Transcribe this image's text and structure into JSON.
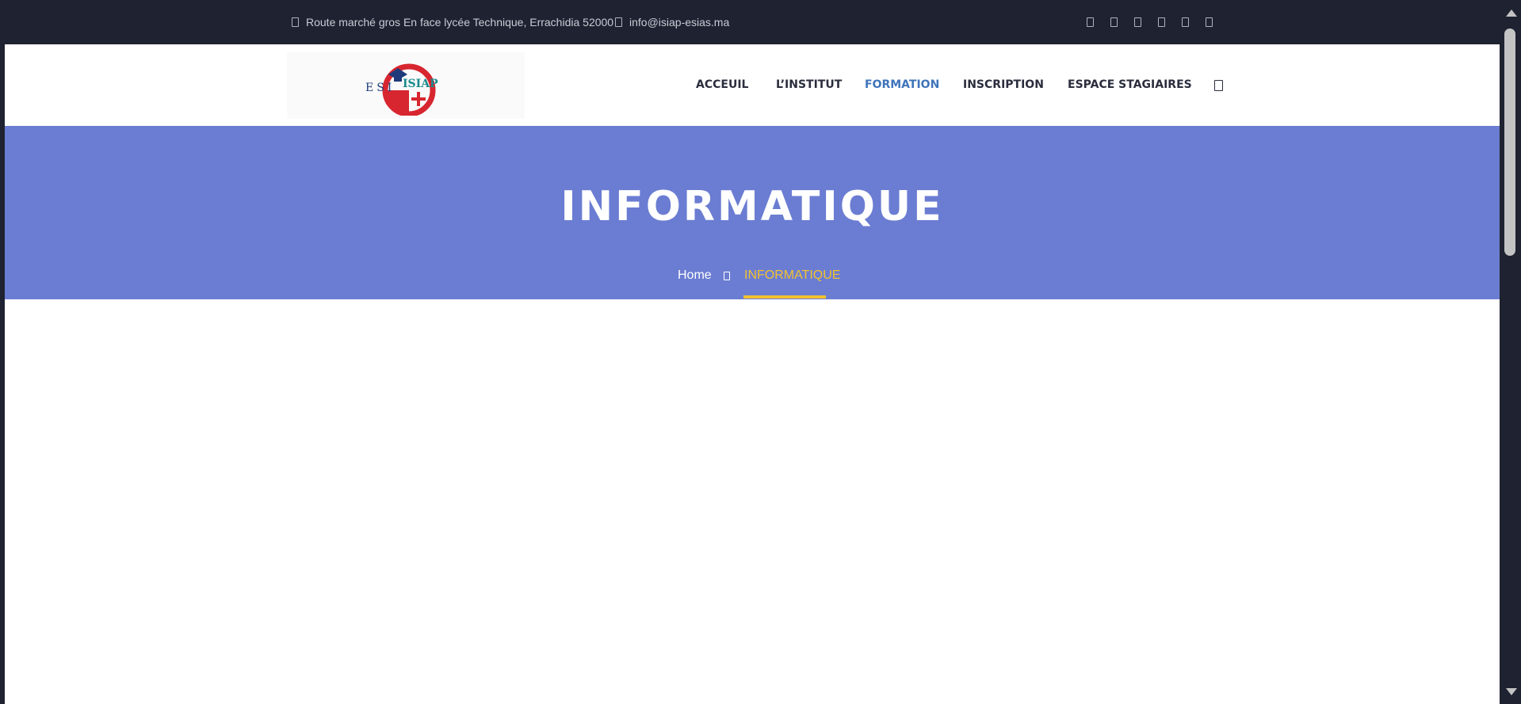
{
  "topbar": {
    "address": "Route marché gros En face lycée Technique, Errachidia 52000",
    "address_icon": "map-marker-icon",
    "email": "info@isiap-esias.ma",
    "email_icon": "envelope-icon",
    "social_icons": [
      "facebook-icon",
      "twitter-icon",
      "instagram-icon",
      "linkedin-icon",
      "youtube-icon",
      "whatsapp-icon"
    ]
  },
  "header": {
    "logo": {
      "text_left": "ESI",
      "text_right": "ISIAP"
    },
    "nav": [
      {
        "label": "ACCEUIL",
        "active": false
      },
      {
        "label": "L’INSTITUT",
        "active": false
      },
      {
        "label": "FORMATION",
        "active": true
      },
      {
        "label": "INSCRIPTION",
        "active": false
      },
      {
        "label": "ESPACE STAGIAIRES",
        "active": false
      }
    ],
    "search_icon": "search-icon"
  },
  "banner": {
    "title": "INFORMATIQUE",
    "breadcrumb": {
      "home": "Home",
      "separator_icon": "chevron-right-icon",
      "current": "INFORMATIQUE"
    }
  },
  "colors": {
    "topbar_bg": "#1f2230",
    "banner_bg": "#6b7dd2",
    "nav_active": "#3f74bb",
    "breadcrumb_accent": "#f2c230"
  }
}
